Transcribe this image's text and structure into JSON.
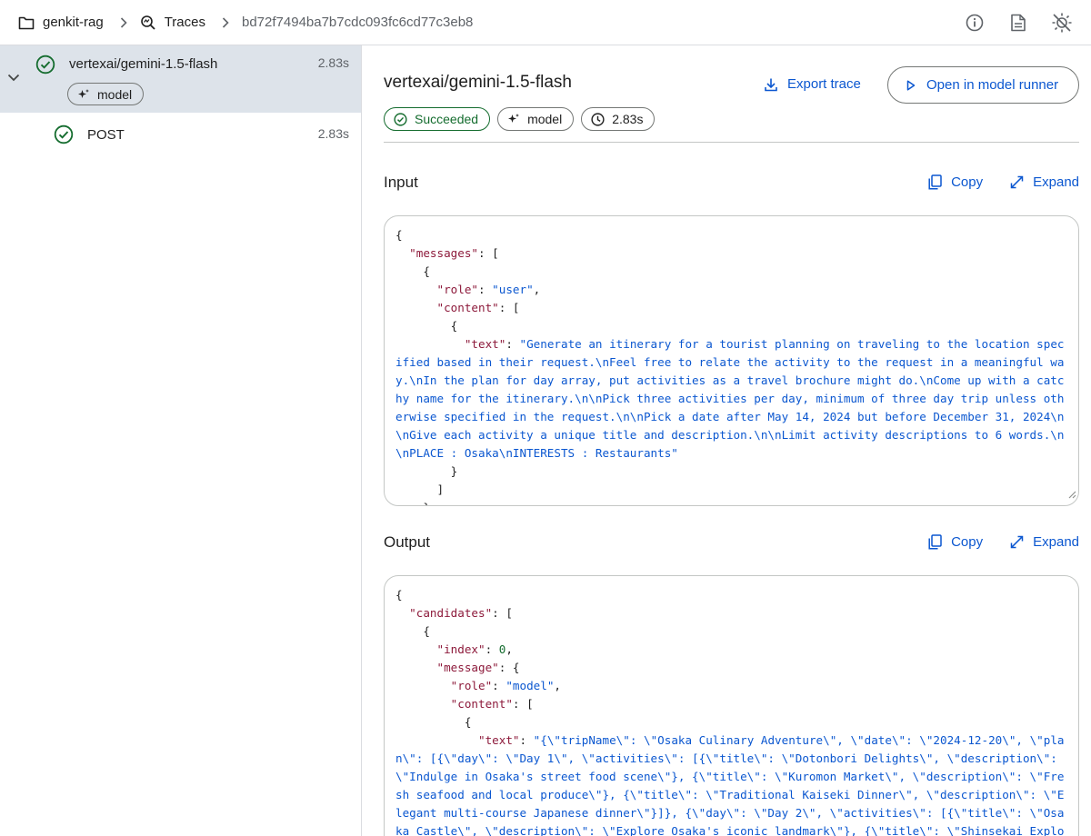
{
  "breadcrumb": {
    "project": "genkit-rag",
    "traces": "Traces",
    "trace_id": "bd72f7494ba7b7cdc093fc6cd77c3eb8"
  },
  "topbar_icons": [
    "info-icon",
    "docs-icon",
    "theme-toggle-icon"
  ],
  "sidebar": {
    "spans": [
      {
        "name": "vertexai/gemini-1.5-flash",
        "duration": "2.83s",
        "badge": "model",
        "status": "success",
        "selected": true,
        "expanded": true
      },
      {
        "name": "POST",
        "duration": "2.83s",
        "status": "success",
        "selected": false
      }
    ]
  },
  "detail": {
    "title": "vertexai/gemini-1.5-flash",
    "export_label": "Export trace",
    "runner_label": "Open in model runner",
    "chips": {
      "status": "Succeeded",
      "type": "model",
      "duration": "2.83s"
    },
    "input": {
      "title": "Input",
      "copy_label": "Copy",
      "expand_label": "Expand",
      "lines": [
        [
          [
            "p",
            "{"
          ]
        ],
        [
          [
            "p",
            "  "
          ],
          [
            "k",
            "\"messages\""
          ],
          [
            "p",
            ": ["
          ]
        ],
        [
          [
            "p",
            "    {"
          ]
        ],
        [
          [
            "p",
            "      "
          ],
          [
            "k",
            "\"role\""
          ],
          [
            "p",
            ": "
          ],
          [
            "s",
            "\"user\""
          ],
          [
            "p",
            ","
          ]
        ],
        [
          [
            "p",
            "      "
          ],
          [
            "k",
            "\"content\""
          ],
          [
            "p",
            ": ["
          ]
        ],
        [
          [
            "p",
            "        {"
          ]
        ],
        [
          [
            "p",
            "          "
          ],
          [
            "k",
            "\"text\""
          ],
          [
            "p",
            ": "
          ],
          [
            "s",
            "\"Generate an itinerary for a tourist planning on traveling to the location specified based in their request.\\nFeel free to relate the activity to the request in a meaningful way.\\nIn the plan for day array, put activities as a travel brochure might do.\\nCome up with a catchy name for the itinerary.\\n\\nPick three activities per day, minimum of three day trip unless otherwise specified in the request.\\n\\nPick a date after May 14, 2024 but before December 31, 2024\\n\\nGive each activity a unique title and description.\\n\\nLimit activity descriptions to 6 words.\\n\\nPLACE : Osaka\\nINTERESTS : Restaurants\""
          ]
        ],
        [
          [
            "p",
            "        }"
          ]
        ],
        [
          [
            "p",
            "      ]"
          ]
        ],
        [
          [
            "p",
            "    },"
          ]
        ]
      ]
    },
    "output": {
      "title": "Output",
      "copy_label": "Copy",
      "expand_label": "Expand",
      "lines": [
        [
          [
            "p",
            "{"
          ]
        ],
        [
          [
            "p",
            "  "
          ],
          [
            "k",
            "\"candidates\""
          ],
          [
            "p",
            ": ["
          ]
        ],
        [
          [
            "p",
            "    {"
          ]
        ],
        [
          [
            "p",
            "      "
          ],
          [
            "k",
            "\"index\""
          ],
          [
            "p",
            ": "
          ],
          [
            "n",
            "0"
          ],
          [
            "p",
            ","
          ]
        ],
        [
          [
            "p",
            "      "
          ],
          [
            "k",
            "\"message\""
          ],
          [
            "p",
            ": {"
          ]
        ],
        [
          [
            "p",
            "        "
          ],
          [
            "k",
            "\"role\""
          ],
          [
            "p",
            ": "
          ],
          [
            "s",
            "\"model\""
          ],
          [
            "p",
            ","
          ]
        ],
        [
          [
            "p",
            "        "
          ],
          [
            "k",
            "\"content\""
          ],
          [
            "p",
            ": ["
          ]
        ],
        [
          [
            "p",
            "          {"
          ]
        ],
        [
          [
            "p",
            "            "
          ],
          [
            "k",
            "\"text\""
          ],
          [
            "p",
            ": "
          ],
          [
            "s",
            "\"{\\\"tripName\\\": \\\"Osaka Culinary Adventure\\\", \\\"date\\\": \\\"2024-12-20\\\", \\\"plan\\\": [{\\\"day\\\": \\\"Day 1\\\", \\\"activities\\\": [{\\\"title\\\": \\\"Dotonbori Delights\\\", \\\"description\\\": \\\"Indulge in Osaka's street food scene\\\"}, {\\\"title\\\": \\\"Kuromon Market\\\", \\\"description\\\": \\\"Fresh seafood and local produce\\\"}, {\\\"title\\\": \\\"Traditional Kaiseki Dinner\\\", \\\"description\\\": \\\"Elegant multi-course Japanese dinner\\\"}]}, {\\\"day\\\": \\\"Day 2\\\", \\\"activities\\\": [{\\\"title\\\": \\\"Osaka Castle\\\", \\\"description\\\": \\\"Explore Osaka's iconic landmark\\\"}, {\\\"title\\\": \\\"Shinsekai Exploration\\\","
          ]
        ]
      ]
    }
  },
  "colors": {
    "accent": "#0b57d0",
    "success": "#146c2e",
    "json_key": "#8d1a3b",
    "selected_row": "#dde3ea"
  }
}
